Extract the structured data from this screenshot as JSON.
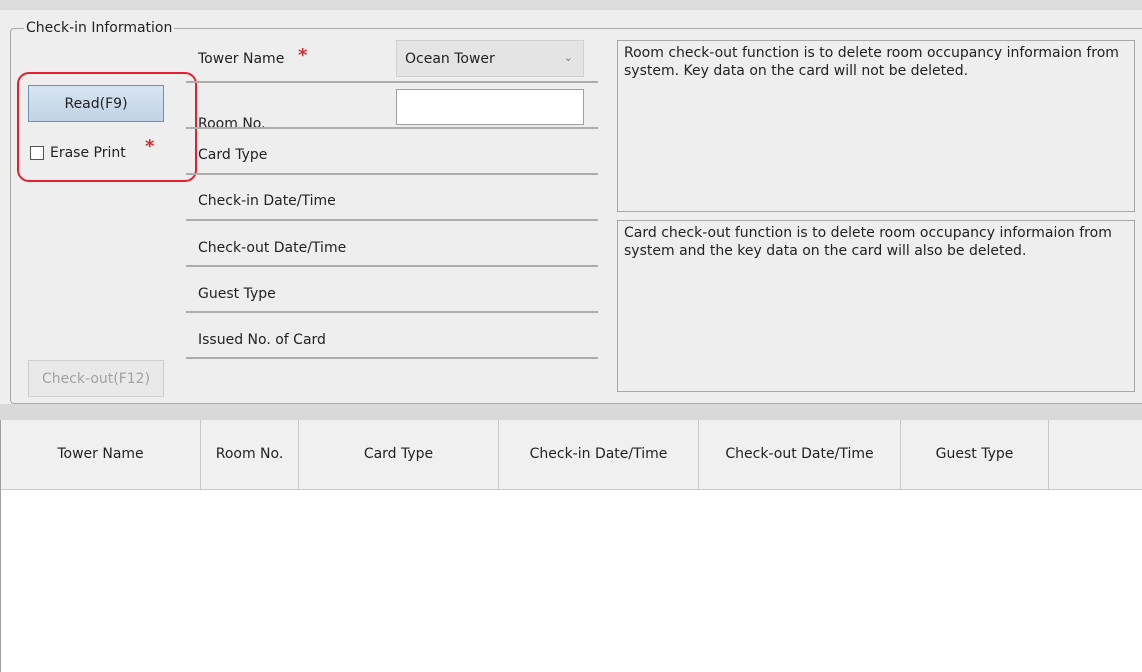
{
  "checkin_info": {
    "title": "Check-in Information",
    "read_button": "Read(F9)",
    "erase_print_label": "Erase Print",
    "required_mark": "*",
    "checkout_button": "Check-out(F12)",
    "fields": {
      "tower_name": "Tower Name",
      "room_no": "Room No.",
      "card_type": "Card Type",
      "checkin_datetime": "Check-in Date/Time",
      "checkout_datetime": "Check-out Date/Time",
      "guest_type": "Guest Type",
      "issued_no_of_card": "Issued No. of Card"
    },
    "tower_select": {
      "selected": "Ocean Tower",
      "icon": "chevron-down-icon"
    },
    "room_input": {
      "value": "",
      "placeholder": ""
    },
    "room_checkout_note": "Room check-out function is to delete room occupancy informaion from system. Key data on the card will not be deleted.",
    "card_checkout_note": "Card check-out function is to delete room occupancy informaion from system and the key data on the card will also be deleted."
  },
  "grid": {
    "columns": [
      "Tower Name",
      "Room No.",
      "Card Type",
      "Check-in Date/Time",
      "Check-out Date/Time",
      "Guest Type"
    ],
    "rows": []
  },
  "colors": {
    "required": "#e0282d",
    "highlight": "#e3202b",
    "read_button": "#c9d9ea"
  }
}
